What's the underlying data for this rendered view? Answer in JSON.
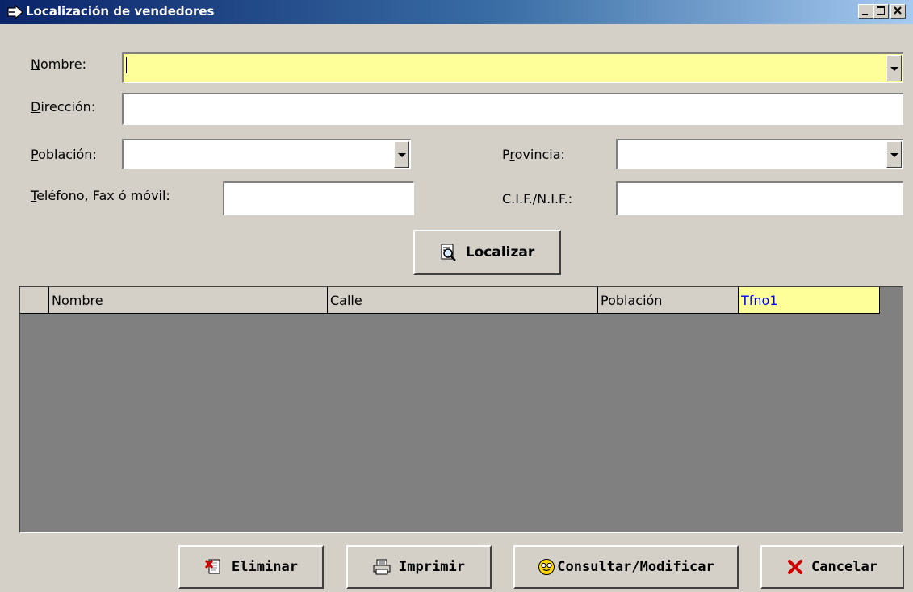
{
  "window": {
    "title": "Localización de vendedores",
    "controls": [
      "minimize",
      "maximize",
      "close"
    ]
  },
  "form": {
    "nombre": {
      "accel": "N",
      "rest": "ombre:",
      "value": ""
    },
    "direccion": {
      "accel": "D",
      "rest": "irección:",
      "value": ""
    },
    "poblacion": {
      "accel": "P",
      "rest": "oblación:",
      "value": ""
    },
    "provincia": {
      "pre": "P",
      "accel": "r",
      "rest": "ovincia:",
      "value": ""
    },
    "telefono": {
      "accel": "T",
      "rest": "eléfono, Fax ó móvil:",
      "value": ""
    },
    "cif": {
      "label": "C.I.F./N.I.F.:",
      "value": ""
    }
  },
  "localizar_button": {
    "label": "Localizar",
    "icon": "magnifier-document-icon"
  },
  "grid": {
    "columns": [
      {
        "label": "",
        "highlighted": false
      },
      {
        "label": "Nombre",
        "highlighted": false
      },
      {
        "label": "Calle",
        "highlighted": false
      },
      {
        "label": "Población",
        "highlighted": false
      },
      {
        "label": "Tfno1",
        "highlighted": true
      }
    ],
    "rows": []
  },
  "footer_buttons": {
    "eliminar": {
      "label": "Eliminar",
      "icon": "delete-x-icon"
    },
    "imprimir": {
      "label": "Imprimir",
      "icon": "printer-icon"
    },
    "consultar": {
      "label": "Consultar/Modificar",
      "icon": "smiley-glasses-icon"
    },
    "cancelar": {
      "label": "Cancelar",
      "icon": "red-x-icon"
    }
  },
  "colors": {
    "window_bg": "#d4d0c8",
    "title_gradient_start": "#0a246a",
    "title_gradient_end": "#a6caf0",
    "highlight_field": "#ffff99",
    "grid_bg": "#808080",
    "grid_highlight_text": "#0000ff",
    "cancel_icon": "#cc0000"
  }
}
